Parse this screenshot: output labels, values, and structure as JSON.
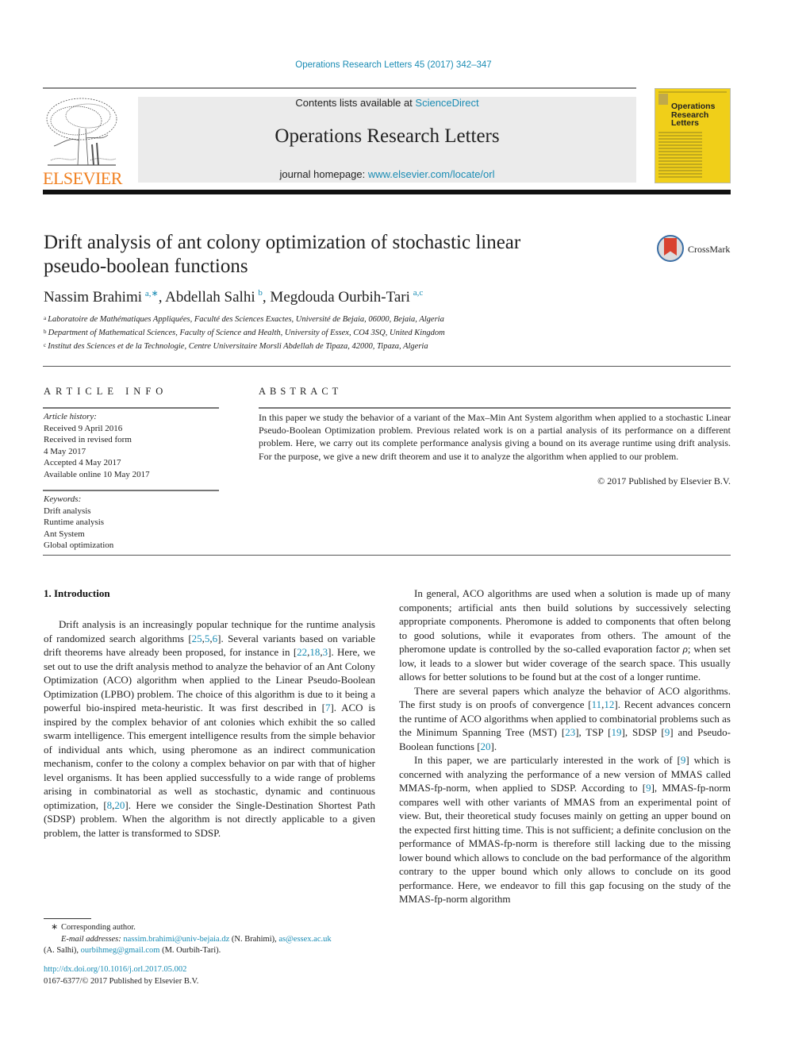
{
  "journal_ref": "Operations Research Letters 45 (2017) 342–347",
  "header": {
    "publisher_logo_text": "ELSEVIER",
    "contents_prefix": "Contents lists available at ",
    "contents_link": "ScienceDirect",
    "journal_title": "Operations Research Letters",
    "homepage_prefix": "journal homepage: ",
    "homepage_link": "www.elsevier.com/locate/orl",
    "cover_title_lines": [
      "Operations",
      "Research",
      "Letters"
    ],
    "cover_color": "#f0cf19"
  },
  "crossmark_label": "CrossMark",
  "article": {
    "title_line1": "Drift analysis of ant colony optimization of stochastic linear",
    "title_line2": "pseudo-boolean functions",
    "authors": [
      {
        "name": "Nassim Brahimi",
        "sup": "a,∗",
        "sep": ", "
      },
      {
        "name": "Abdellah Salhi",
        "sup": "b",
        "sep": ", "
      },
      {
        "name": "Megdouda Ourbih-Tari",
        "sup": "a,c",
        "sep": ""
      }
    ],
    "affiliations": [
      {
        "mark": "a",
        "text": "Laboratoire de Mathématiques Appliquées, Faculté des Sciences Exactes, Université de Bejaia, 06000, Bejaia, Algeria"
      },
      {
        "mark": "b",
        "text": "Department of Mathematical Sciences, Faculty of Science and Health, University of Essex, CO4 3SQ, United Kingdom"
      },
      {
        "mark": "c",
        "text": "Institut des Sciences et de la Technologie, Centre Universitaire Morsli Abdellah de Tipaza, 42000, Tipaza, Algeria"
      }
    ]
  },
  "article_info": {
    "heading": "ARTICLE INFO",
    "history_label": "Article history:",
    "history": [
      "Received 9 April 2016",
      "Received in revised form",
      "4 May 2017",
      "Accepted 4 May 2017",
      "Available online 10 May 2017"
    ],
    "keywords_label": "Keywords:",
    "keywords": [
      "Drift analysis",
      "Runtime analysis",
      "Ant System",
      "Global optimization"
    ]
  },
  "abstract": {
    "heading": "ABSTRACT",
    "text": "In this paper we study the behavior of a variant of the Max–Min Ant System algorithm when applied to a stochastic Linear Pseudo-Boolean Optimization problem. Previous related work is on a partial analysis of its performance on a different problem. Here, we carry out its complete performance analysis giving a bound on its average runtime using drift analysis. For the purpose, we give a new drift theorem and use it to analyze the algorithm when applied to our problem.",
    "copyright": "© 2017 Published by Elsevier B.V."
  },
  "body": {
    "section_heading": "1.  Introduction",
    "left_paragraphs": [
      [
        {
          "t": "Drift analysis is an increasingly popular technique for the runtime analysis of randomized search algorithms ["
        },
        {
          "l": "25"
        },
        {
          "t": ","
        },
        {
          "l": "5"
        },
        {
          "t": ","
        },
        {
          "l": "6"
        },
        {
          "t": "]. Several variants based on variable drift theorems have already been proposed, for instance in ["
        },
        {
          "l": "22"
        },
        {
          "t": ","
        },
        {
          "l": "18"
        },
        {
          "t": ","
        },
        {
          "l": "3"
        },
        {
          "t": "]. Here, we set out to use the drift analysis method to analyze the behavior of an Ant Colony Optimization (ACO) algorithm when applied to the Linear Pseudo-Boolean Optimization (LPBO) problem. The choice of this algorithm is due to it being a powerful bio-inspired meta-heuristic. It was first described in ["
        },
        {
          "l": "7"
        },
        {
          "t": "]. ACO is inspired by the complex behavior of ant colonies which exhibit the so called swarm intelligence. This emergent intelligence results from the simple behavior of individual ants which, using pheromone as an indirect communication mechanism, confer to the colony a complex behavior on par with that of higher level organisms. It has been applied successfully to a wide range of problems arising in combinatorial as well as stochastic, dynamic and continuous optimization, ["
        },
        {
          "l": "8"
        },
        {
          "t": ","
        },
        {
          "l": "20"
        },
        {
          "t": "]. Here we consider the Single-Destination Shortest Path (SDSP) problem. When the algorithm is not directly applicable to a given problem, the latter is transformed to SDSP."
        }
      ]
    ],
    "right_paragraphs": [
      [
        {
          "t": "In general, ACO algorithms are used when a solution is made up of many components; artificial ants then build solutions by successively selecting appropriate components. Pheromone is added to components that often belong to good solutions, while it evaporates from others. The amount of the pheromone update is controlled by the so-called evaporation factor "
        },
        {
          "i": "ρ"
        },
        {
          "t": "; when set low, it leads to a slower but wider coverage of the search space. This usually allows for better solutions to be found but at the cost of a longer runtime."
        }
      ],
      [
        {
          "t": "There are several papers which analyze the behavior of ACO algorithms. The first study is on proofs of convergence ["
        },
        {
          "l": "11"
        },
        {
          "t": ","
        },
        {
          "l": "12"
        },
        {
          "t": "]. Recent advances concern the runtime of ACO algorithms when applied to combinatorial problems such as the Minimum Spanning Tree (MST) ["
        },
        {
          "l": "23"
        },
        {
          "t": "], TSP ["
        },
        {
          "l": "19"
        },
        {
          "t": "], SDSP ["
        },
        {
          "l": "9"
        },
        {
          "t": "] and Pseudo-Boolean functions ["
        },
        {
          "l": "20"
        },
        {
          "t": "]."
        }
      ],
      [
        {
          "t": "In this paper, we are particularly interested in the work of ["
        },
        {
          "l": "9"
        },
        {
          "t": "] which is concerned with analyzing the performance of a new version of MMAS called MMAS-fp-norm, when applied to SDSP. According to ["
        },
        {
          "l": "9"
        },
        {
          "t": "], MMAS-fp-norm compares well with other variants of MMAS from an experimental point of view. But, their theoretical study focuses mainly on getting an upper bound on the expected first hitting time. This is not sufficient; a definite conclusion on the performance of MMAS-fp-norm is therefore still lacking due to the missing lower bound which allows to conclude on the bad performance of the algorithm contrary to the upper bound which only allows to conclude on its good performance. Here, we endeavor to fill this gap focusing on the study of the MMAS-fp-norm algorithm"
        }
      ]
    ]
  },
  "footnote": {
    "star": "∗",
    "corresponding": "Corresponding author.",
    "email_label": "E-mail addresses:",
    "emails": [
      {
        "addr": "nassim.brahimi@univ-bejaia.dz",
        "who": " (N. Brahimi), "
      },
      {
        "addr": "as@essex.ac.uk",
        "who": " (A. Salhi), "
      },
      {
        "addr": "ourbihmeg@gmail.com",
        "who": " (M. Ourbih-Tari)."
      }
    ]
  },
  "doi": {
    "link": "http://dx.doi.org/10.1016/j.orl.2017.05.002",
    "issn_line": "0167-6377/© 2017 Published by Elsevier B.V."
  }
}
